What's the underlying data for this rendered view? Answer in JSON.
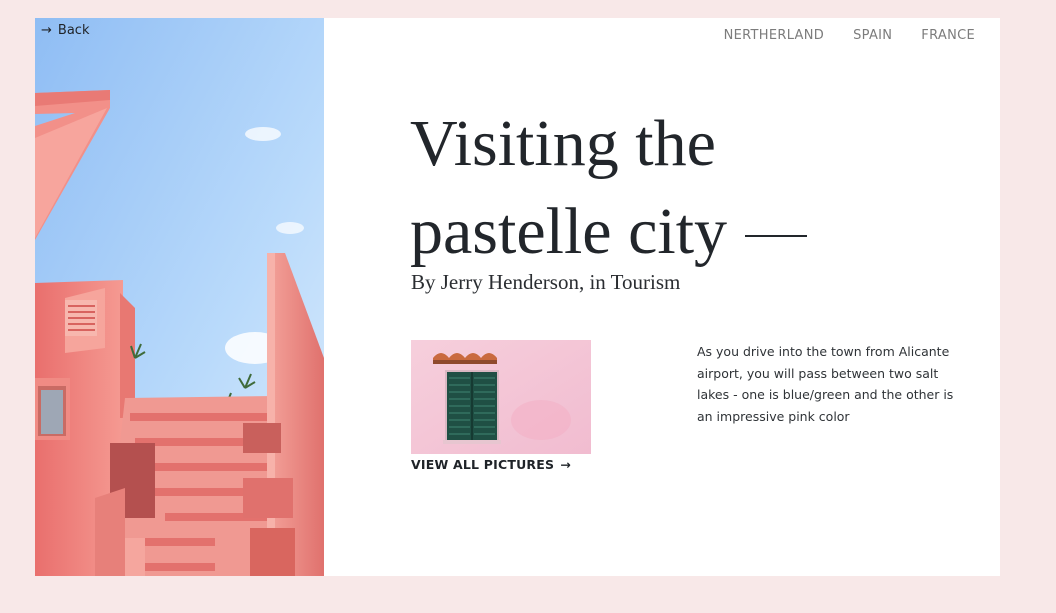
{
  "header": {
    "back_label": "Back",
    "nav": [
      "NERTHERLAND",
      "SPAIN",
      "FRANCE"
    ]
  },
  "article": {
    "title_line1": "Visiting the",
    "title_line2": "pastelle city",
    "byline": "By Jerry Henderson, in Tourism",
    "view_all_label": "VIEW ALL PICTURES",
    "excerpt": "As you drive into the town from Alicante airport, you will pass between two salt lakes - one is blue/green and the other is an impressive pink color"
  },
  "colors": {
    "page_bg": "#f8e8e8",
    "card_bg": "#ffffff",
    "sky": "#a9cff7",
    "building_pink": "#ef8a85",
    "shutter_green": "#1f4f44"
  },
  "icons": {
    "back": "arrow-right-icon",
    "view_all": "arrow-right-icon"
  }
}
